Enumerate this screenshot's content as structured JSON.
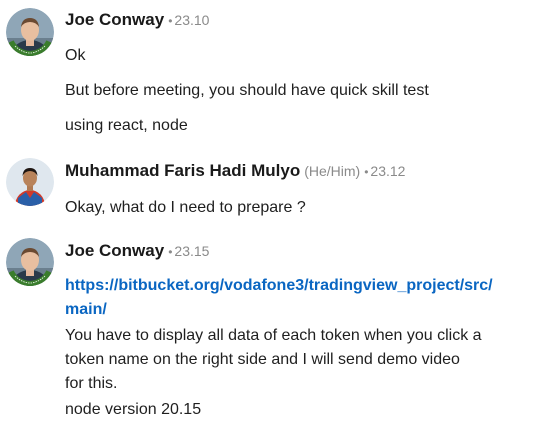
{
  "messages": [
    {
      "sender": "Joe Conway",
      "time": "23.10",
      "avatar_icon": "profile-photo-opentowork",
      "lines": [
        "Ok",
        "But before meeting, you should have quick skill test",
        "using react, node"
      ]
    },
    {
      "sender": "Muhammad Faris Hadi Mulyo",
      "pronouns": "(He/Him)",
      "time": "23.12",
      "avatar_icon": "profile-photo",
      "lines": [
        "Okay, what do I need to prepare ?"
      ]
    },
    {
      "sender": "Joe Conway",
      "time": "23.15",
      "avatar_icon": "profile-photo-opentowork",
      "link_lines": [
        "https://bitbucket.org/vodafone3/tradingview_project/src/",
        "main/"
      ],
      "lines": [
        "You have to display all data of each token when you click a",
        "token name on the right side and I will send demo video",
        "for this.",
        "node version 20.15"
      ]
    }
  ],
  "separator": "•",
  "badge_text": "#OPENTOWORK",
  "colors": {
    "link": "#0a66c2",
    "opentowork_ring": "#3a7d2c",
    "meta": "#8a8a8a"
  }
}
